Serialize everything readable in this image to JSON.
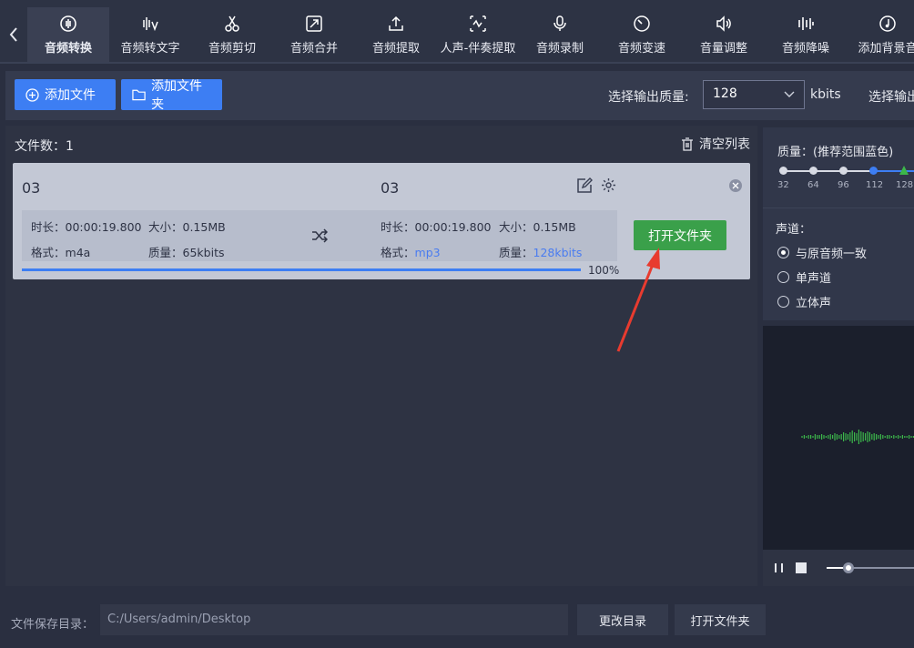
{
  "toolbar": {
    "back_icon": "chevron-left-icon",
    "tabs": [
      {
        "label": "音频转换",
        "icon": "audio-convert-icon",
        "active": true
      },
      {
        "label": "音频转文字",
        "icon": "speech-to-text-icon"
      },
      {
        "label": "音频剪切",
        "icon": "scissors-icon"
      },
      {
        "label": "音频合并",
        "icon": "merge-icon"
      },
      {
        "label": "音频提取",
        "icon": "upload-icon"
      },
      {
        "label": "人声-伴奏提取",
        "icon": "vocal-extract-icon"
      },
      {
        "label": "音频录制",
        "icon": "microphone-icon"
      },
      {
        "label": "音频变速",
        "icon": "speed-icon"
      },
      {
        "label": "音量调整",
        "icon": "volume-icon"
      },
      {
        "label": "音频降噪",
        "icon": "equalizer-icon"
      },
      {
        "label": "添加背景音",
        "icon": "music-note-icon"
      }
    ]
  },
  "actions": {
    "add_file": "添加文件",
    "add_folder": "添加文件夹",
    "quality_label": "选择输出质量:",
    "quality_value": "128",
    "quality_unit": "kbits",
    "format_label": "选择输出格式"
  },
  "list": {
    "count_label": "文件数：",
    "count": "1",
    "clear_label": "清空列表",
    "items": [
      {
        "src_name": "03",
        "src_duration": "时长：00:00:19.800",
        "src_size": "大小：0.15MB",
        "src_format_label": "格式：",
        "src_format": "m4a",
        "src_quality_label": "质量：",
        "src_quality": "65kbits",
        "dst_name": "03",
        "dst_duration": "时长：00:00:19.800",
        "dst_size": "大小：0.15MB",
        "dst_format_label": "格式：",
        "dst_format": "mp3",
        "dst_quality_label": "质量：",
        "dst_quality": "128kbits",
        "open_label": "打开文件夹",
        "progress": 1.0,
        "progress_text": "100%"
      }
    ]
  },
  "settings": {
    "quality_title": "质量：(推荐范围蓝色)",
    "ticks": [
      "32",
      "64",
      "96",
      "112",
      "128"
    ],
    "channel_title": "声道：",
    "channels": [
      {
        "label": "与原音频一致",
        "selected": true
      },
      {
        "label": "单声道",
        "selected": false
      },
      {
        "label": "立体声",
        "selected": false
      }
    ]
  },
  "bottom": {
    "save_label": "文件保存目录：",
    "save_path": "C:/Users/admin/Desktop",
    "change_dir": "更改目录",
    "open_folder": "打开文件夹"
  },
  "colors": {
    "accent": "#3d7ef3",
    "success": "#3aa04a",
    "annotation": "#e83b2f",
    "waveform": "#3cb84a"
  }
}
